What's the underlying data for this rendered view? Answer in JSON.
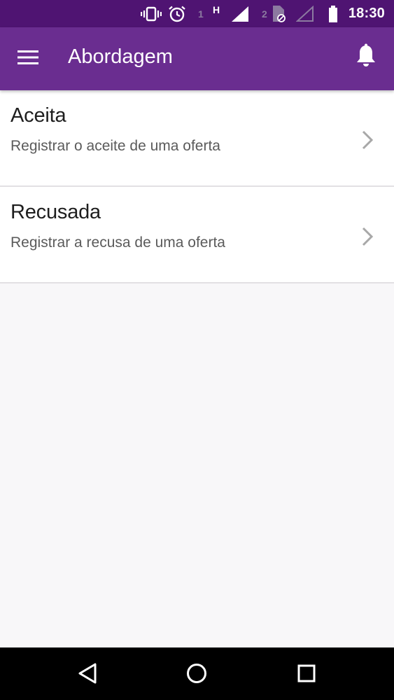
{
  "status_bar": {
    "sim1_label": "1",
    "network_type": "H",
    "sim2_label": "2",
    "time": "18:30"
  },
  "app_bar": {
    "title": "Abordagem",
    "menu_icon": "menu-icon",
    "notification_icon": "bell-icon"
  },
  "list": {
    "items": [
      {
        "title": "Aceita",
        "subtitle": "Registrar o aceite de uma oferta"
      },
      {
        "title": "Recusada",
        "subtitle": "Registrar a recusa de uma oferta"
      }
    ]
  },
  "nav_bar": {
    "back_icon": "back-triangle-icon",
    "home_icon": "home-circle-icon",
    "recents_icon": "recents-square-icon"
  },
  "colors": {
    "status_bar": "#4f1472",
    "app_bar": "#6a2d90",
    "background": "#f8f7f9",
    "divider": "#e2e0e3"
  }
}
